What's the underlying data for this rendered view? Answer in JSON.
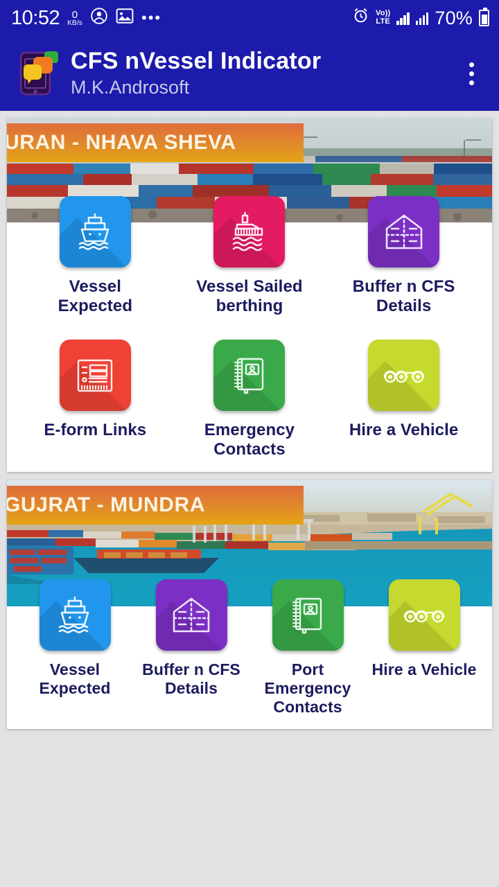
{
  "status_bar": {
    "time": "10:52",
    "net_speed_value": "0",
    "net_speed_unit": "KB/s",
    "icons": [
      "account-circle-icon",
      "image-icon",
      "more-horizontal-icon"
    ],
    "alarm_icon": "alarm-icon",
    "volte_top": "Vo))",
    "volte_bottom": "LTE",
    "battery_percent": "70%"
  },
  "app_bar": {
    "logo_icon": "app-logo-icon",
    "title": "CFS nVessel Indicator",
    "subtitle": "M.K.Androsoft",
    "overflow_icon": "overflow-menu-icon"
  },
  "colors": {
    "app_bar": "#1c1bab",
    "page_bg": "#e2e2e4",
    "label": "#1b1b5e",
    "banner_from": "#df6c3c",
    "banner_to": "#e5a514",
    "blue": "#2196ec",
    "pink": "#e41a62",
    "purple": "#7c2fc4",
    "red": "#ef4135",
    "green": "#3aa94a",
    "lime": "#c6d92e"
  },
  "cards": [
    {
      "banner_title": "URAN - NHAVA SHEVA",
      "hero_image": "container-yard-photo",
      "columns": 3,
      "tiles": [
        {
          "label": "Vessel\nExpected",
          "label_line1": "Vessel",
          "label_line2": "Expected",
          "color": "#2196ec",
          "icon": "vessel-front-icon"
        },
        {
          "label": "Vessel Sailed\nberthing",
          "label_line1": "Vessel Sailed",
          "label_line2": "berthing",
          "color": "#e41a62",
          "icon": "vessel-side-icon"
        },
        {
          "label": "Buffer n CFS\nDetails",
          "label_line1": "Buffer n CFS",
          "label_line2": "Details",
          "color": "#7c2fc4",
          "icon": "warehouse-icon"
        },
        {
          "label": "E-form Links",
          "label_line1": "E-form Links",
          "label_line2": "",
          "color": "#ef4135",
          "icon": "eform-icon"
        },
        {
          "label": "Emergency\nContacts",
          "label_line1": "Emergency",
          "label_line2": "Contacts",
          "color": "#3aa94a",
          "icon": "contact-book-icon"
        },
        {
          "label": "Hire a Vehicle",
          "label_line1": "Hire a Vehicle",
          "label_line2": "",
          "color": "#c6d92e",
          "icon": "vehicle-axle-icon"
        }
      ]
    },
    {
      "banner_title": "GUJRAT - MUNDRA",
      "hero_image": "mundra-port-aerial-photo",
      "columns": 4,
      "tiles": [
        {
          "label": "Vessel\nExpected",
          "label_line1": "Vessel",
          "label_line2": "Expected",
          "color": "#2196ec",
          "icon": "vessel-front-icon"
        },
        {
          "label": "Buffer n CFS\nDetails",
          "label_line1": "Buffer n CFS",
          "label_line2": "Details",
          "color": "#7c2fc4",
          "icon": "warehouse-icon"
        },
        {
          "label": "Port Emergency\nContacts",
          "label_line1": "Port Emergency",
          "label_line2": "Contacts",
          "color": "#3aa94a",
          "icon": "contact-book-icon"
        },
        {
          "label": "Hire a Vehicle",
          "label_line1": "Hire a Vehicle",
          "label_line2": "",
          "color": "#c6d92e",
          "icon": "vehicle-axle-icon"
        }
      ]
    }
  ]
}
